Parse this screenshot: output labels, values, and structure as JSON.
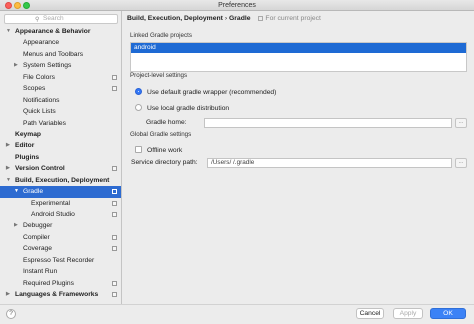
{
  "window": {
    "title": "Preferences"
  },
  "search": {
    "placeholder": "Search"
  },
  "sidebar": {
    "items": [
      {
        "label": "Appearance & Behavior",
        "bold": true,
        "level": 0,
        "arrow": "expanded",
        "copy": false,
        "selected": false
      },
      {
        "label": "Appearance",
        "bold": false,
        "level": 1,
        "arrow": "",
        "copy": false,
        "selected": false
      },
      {
        "label": "Menus and Toolbars",
        "bold": false,
        "level": 1,
        "arrow": "",
        "copy": false,
        "selected": false
      },
      {
        "label": "System Settings",
        "bold": false,
        "level": 1,
        "arrow": "collapsed",
        "copy": false,
        "selected": false
      },
      {
        "label": "File Colors",
        "bold": false,
        "level": 1,
        "arrow": "",
        "copy": true,
        "selected": false
      },
      {
        "label": "Scopes",
        "bold": false,
        "level": 1,
        "arrow": "",
        "copy": true,
        "selected": false
      },
      {
        "label": "Notifications",
        "bold": false,
        "level": 1,
        "arrow": "",
        "copy": false,
        "selected": false
      },
      {
        "label": "Quick Lists",
        "bold": false,
        "level": 1,
        "arrow": "",
        "copy": false,
        "selected": false
      },
      {
        "label": "Path Variables",
        "bold": false,
        "level": 1,
        "arrow": "",
        "copy": false,
        "selected": false
      },
      {
        "label": "Keymap",
        "bold": true,
        "level": 0,
        "arrow": "",
        "copy": false,
        "selected": false
      },
      {
        "label": "Editor",
        "bold": true,
        "level": 0,
        "arrow": "collapsed",
        "copy": false,
        "selected": false
      },
      {
        "label": "Plugins",
        "bold": true,
        "level": 0,
        "arrow": "",
        "copy": false,
        "selected": false
      },
      {
        "label": "Version Control",
        "bold": true,
        "level": 0,
        "arrow": "collapsed",
        "copy": true,
        "selected": false
      },
      {
        "label": "Build, Execution, Deployment",
        "bold": true,
        "level": 0,
        "arrow": "expanded",
        "copy": false,
        "selected": false
      },
      {
        "label": "Gradle",
        "bold": false,
        "level": 1,
        "arrow": "expanded",
        "copy": true,
        "selected": true
      },
      {
        "label": "Experimental",
        "bold": false,
        "level": 2,
        "arrow": "",
        "copy": true,
        "selected": false
      },
      {
        "label": "Android Studio",
        "bold": false,
        "level": 2,
        "arrow": "",
        "copy": true,
        "selected": false
      },
      {
        "label": "Debugger",
        "bold": false,
        "level": 1,
        "arrow": "collapsed",
        "copy": false,
        "selected": false
      },
      {
        "label": "Compiler",
        "bold": false,
        "level": 1,
        "arrow": "",
        "copy": true,
        "selected": false
      },
      {
        "label": "Coverage",
        "bold": false,
        "level": 1,
        "arrow": "",
        "copy": true,
        "selected": false
      },
      {
        "label": "Espresso Test Recorder",
        "bold": false,
        "level": 1,
        "arrow": "",
        "copy": false,
        "selected": false
      },
      {
        "label": "Instant Run",
        "bold": false,
        "level": 1,
        "arrow": "",
        "copy": false,
        "selected": false
      },
      {
        "label": "Required Plugins",
        "bold": false,
        "level": 1,
        "arrow": "",
        "copy": true,
        "selected": false
      },
      {
        "label": "Languages & Frameworks",
        "bold": true,
        "level": 0,
        "arrow": "collapsed",
        "copy": true,
        "selected": false
      }
    ]
  },
  "main": {
    "breadcrumb": {
      "parent": "Build, Execution, Deployment",
      "separator": "›",
      "current": "Gradle",
      "scope": "For current project"
    },
    "linked": {
      "title": "Linked Gradle projects",
      "projects": [
        "android"
      ]
    },
    "project_level": {
      "title": "Project-level settings",
      "option_wrapper": "Use default gradle wrapper (recommended)",
      "option_local": "Use local gradle distribution",
      "gradle_home_label": "Gradle home:",
      "gradle_home_value": ""
    },
    "global": {
      "title": "Global Gradle settings",
      "offline_label": "Offline work",
      "service_dir_label": "Service directory path:",
      "service_dir_value": "/Users/                 /.gradle",
      "browse": "..."
    }
  },
  "footer": {
    "help": "?",
    "cancel": "Cancel",
    "apply": "Apply",
    "ok": "OK"
  }
}
